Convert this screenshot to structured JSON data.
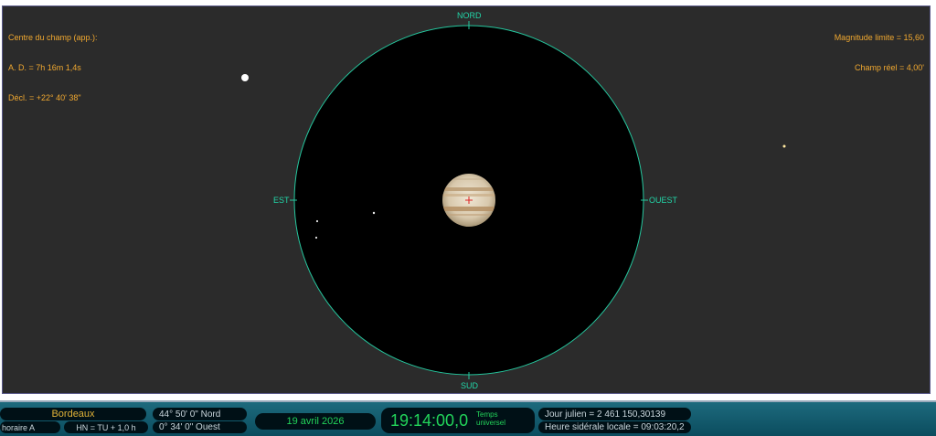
{
  "field_center": {
    "title": "Centre du champ (app.):",
    "ra": "A. D. = 7h 16m 1,4s",
    "dec": "Décl. = +22° 40' 38\""
  },
  "limits": {
    "magnitude": "Magnitude limite = 15,60",
    "field": "Champ réel = 4,00'"
  },
  "cardinals": {
    "north": "NORD",
    "south": "SUD",
    "east": "EST",
    "west": "OUEST"
  },
  "colors": {
    "sky_background": "#2b2b2b",
    "field_circle": "#000000",
    "circle_outline": "#25c79e",
    "info_text": "#f0a830",
    "cardinal_text": "#22d6a8",
    "status_text": "#22d45a"
  },
  "status": {
    "location": "Bordeaux",
    "latitude": "44° 50' 0\" Nord",
    "longitude": "0° 34' 0\" Ouest",
    "time_zone_label": "horaire A",
    "hn_offset": "HN = TU + 1,0 h",
    "date": "19 avril 2026",
    "time": "19:14:00,0",
    "time_label_line1": "Temps",
    "time_label_line2": "universel",
    "julian_day": "Jour julien = 2 461 150,30139",
    "sidereal_time": "Heure sidérale locale =  09:03:20,2"
  }
}
